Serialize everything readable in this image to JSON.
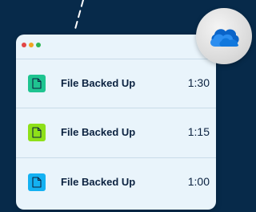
{
  "window": {
    "title_dots": [
      "close",
      "minimize",
      "maximize"
    ]
  },
  "rows": [
    {
      "label": "File Backed Up",
      "time": "1:30",
      "icon": "file-icon",
      "tile_color": "#1fc490"
    },
    {
      "label": "File Backed Up",
      "time": "1:15",
      "icon": "file-icon",
      "tile_color": "#8ee019"
    },
    {
      "label": "File Backed Up",
      "time": "1:00",
      "icon": "file-icon",
      "tile_color": "#14b1f2"
    }
  ],
  "badge": {
    "icon": "cloud-icon",
    "cloud_colors": [
      "#0a64c9",
      "#2c8ef0",
      "#1178dd"
    ]
  },
  "colors": {
    "background": "#072a4a",
    "window": "#e9f4fb",
    "text": "#0b2240"
  }
}
